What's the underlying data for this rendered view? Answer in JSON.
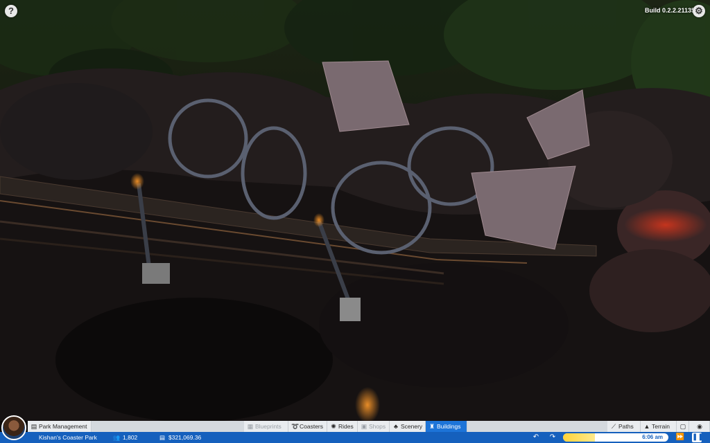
{
  "build": "Build 0.2.2.21135",
  "help_label": "?",
  "toolbar": {
    "park_management": "Park Management",
    "blueprints": "Blueprints",
    "coasters": "Coasters",
    "rides": "Rides",
    "shops": "Shops",
    "scenery": "Scenery",
    "buildings": "Buildings",
    "paths": "Paths",
    "terrain": "Terrain"
  },
  "status": {
    "park_name": "Kishan's Coaster Park",
    "guests": "1,802",
    "money": "$321,069.36",
    "time": "6:06 am",
    "day_progress": 0.3
  },
  "colors": {
    "accent": "#1560bd",
    "active_tab": "#1d74d8",
    "toolbar_bg": "#e9ecef",
    "sun": "#ffd33a"
  },
  "icons": {
    "help": "question-mark-icon",
    "settings": "gear-icon",
    "guests": "people-icon",
    "money": "coins-icon",
    "undo": "undo-icon",
    "redo": "redo-icon",
    "fast_forward": "fast-forward-icon",
    "pause": "pause-icon"
  }
}
